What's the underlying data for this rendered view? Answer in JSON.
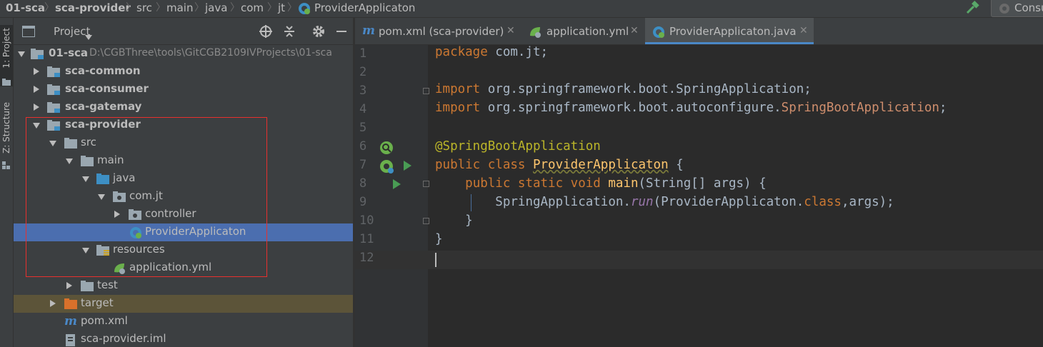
{
  "breadcrumb": [
    "01-sca",
    "sca-provider",
    "src",
    "main",
    "java",
    "com",
    "jt",
    "ProviderApplicaton"
  ],
  "toolbar": {
    "run_config_label": "Consu"
  },
  "side_tabs": {
    "project": "1: Project",
    "structure": "Z: Structure"
  },
  "project_panel": {
    "title": "Project"
  },
  "tree": [
    {
      "label": "01-sca",
      "path": "D:\\CGBThree\\tools\\GitCGB2109IVProjects\\01-sca"
    },
    {
      "label": "sca-common"
    },
    {
      "label": "sca-consumer"
    },
    {
      "label": "sca-gatemay"
    },
    {
      "label": "sca-provider"
    },
    {
      "label": "src"
    },
    {
      "label": "main"
    },
    {
      "label": "java"
    },
    {
      "label": "com.jt"
    },
    {
      "label": "controller"
    },
    {
      "label": "ProviderApplicaton"
    },
    {
      "label": "resources"
    },
    {
      "label": "application.yml"
    },
    {
      "label": "test"
    },
    {
      "label": "target"
    },
    {
      "label": "pom.xml"
    },
    {
      "label": "sca-provider.iml"
    }
  ],
  "tabs": [
    {
      "label": "pom.xml (sca-provider)"
    },
    {
      "label": "application.yml"
    },
    {
      "label": "ProviderApplicaton.java"
    }
  ],
  "line_numbers": [
    "1",
    "2",
    "3",
    "4",
    "5",
    "6",
    "7",
    "8",
    "9",
    "10",
    "11",
    "12"
  ],
  "code": {
    "l1_kw": "package",
    "l1_rest": " com.jt;",
    "l3_kw": "import",
    "l3_rest": " org.springframework.boot.SpringApplication;",
    "l4_kw": "import",
    "l4_pkg": " org.springframework.boot.autoconfigure.",
    "l4_cls": "SpringBootApplication",
    "l4_end": ";",
    "l6_ann": "@SpringBootApplication",
    "l7_kw": "public class",
    "l7_sp": " ",
    "l7_cls": "ProviderApplicaton",
    "l7_end": " {",
    "l8_indent": "    ",
    "l8_kw": "public static void",
    "l8_sp": " ",
    "l8_method": "main",
    "l8_rest": "(String[] args) {",
    "l9_indent": "        ",
    "l9_a": "SpringApplication.",
    "l9_run": "run",
    "l9_b": "(ProviderApplicaton.",
    "l9_kw": "class",
    "l9_c": ",args);",
    "l10": "    }",
    "l11": "}"
  }
}
